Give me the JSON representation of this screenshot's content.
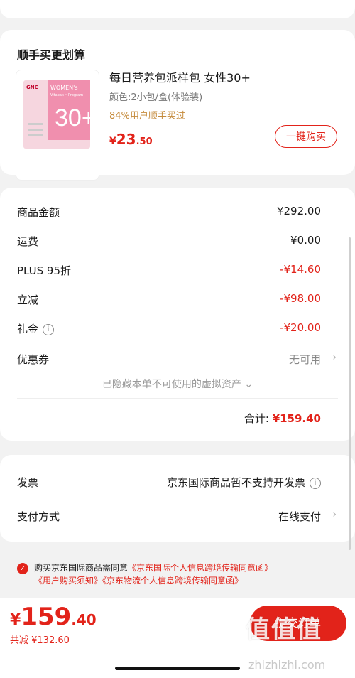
{
  "recommend": {
    "section_title": "顺手买更划算",
    "product": {
      "name": "每日营养包派样包 女性30+",
      "spec": "颜色:2小包/盒(体验装)",
      "buy_rate": "84%用户顺手买过",
      "price_symbol": "¥",
      "price_int": "23",
      "price_dec": ".50",
      "buy_button": "一键购买",
      "image": {
        "brand": "GNC",
        "title": "WOMEN's",
        "subtitle": "Vitapak • Program",
        "number": "30+"
      }
    }
  },
  "summary": {
    "rows": [
      {
        "label": "商品金额",
        "value": "¥292.00",
        "color": "normal"
      },
      {
        "label": "运费",
        "value": "¥0.00",
        "color": "normal"
      },
      {
        "label": "PLUS 95折",
        "value": "-¥14.60",
        "color": "red"
      },
      {
        "label": "立减",
        "value": "-¥98.00",
        "color": "red"
      },
      {
        "label": "礼金",
        "value": "-¥20.00",
        "color": "red"
      },
      {
        "label": "优惠券",
        "value": "无可用",
        "color": "grey"
      }
    ],
    "hidden_note": "已隐藏本单不可使用的虚拟资产 ⌄",
    "total_label": "合计:",
    "total_value": "¥159.40"
  },
  "invoice": {
    "label": "发票",
    "value": "京东国际商品暂不支持开发票"
  },
  "payment": {
    "label": "支付方式",
    "value": "在线支付"
  },
  "consent": {
    "prefix": "购买京东国际商品需同意",
    "link1": "《京东国际个人信息跨境传输同意函》",
    "link2": "《用户购买须知》",
    "link3": "《京东物流个人信息跨境传输同意函》"
  },
  "bottom": {
    "price_symbol": "¥",
    "price_int": "159",
    "price_dec": ".40",
    "saving": "共减 ¥132.60",
    "submit": "提交订单"
  },
  "watermark": {
    "text": "值值值",
    "url": "zhizhizhi.com"
  },
  "colors": {
    "accent": "#e2231a",
    "gold": "#c58a3a"
  }
}
